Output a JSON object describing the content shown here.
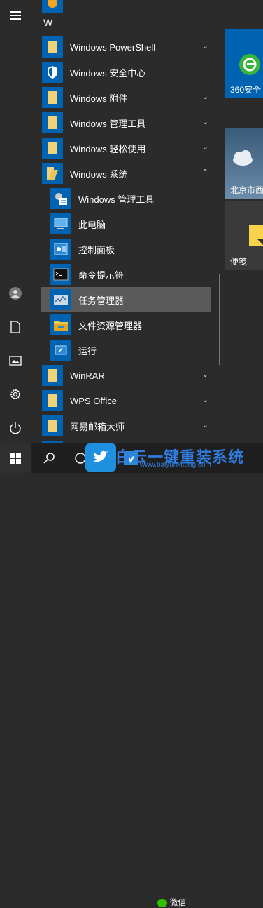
{
  "list": {
    "section_letter": "W",
    "items": [
      {
        "label": "Windows PowerShell",
        "chevron": "⌄"
      },
      {
        "label": "Windows 安全中心"
      },
      {
        "label": "Windows 附件",
        "chevron": "⌄"
      },
      {
        "label": "Windows 管理工具",
        "chevron": "⌄"
      },
      {
        "label": "Windows 轻松使用",
        "chevron": "⌄"
      },
      {
        "label": "Windows 系统",
        "chevron": "⌃"
      },
      {
        "label": "Windows 管理工具"
      },
      {
        "label": "此电脑"
      },
      {
        "label": "控制面板"
      },
      {
        "label": "命令提示符"
      },
      {
        "label": "任务管理器"
      },
      {
        "label": "文件资源管理器"
      },
      {
        "label": "运行"
      },
      {
        "label": "WinRAR",
        "chevron": "⌄"
      },
      {
        "label": "WPS Office",
        "chevron": "⌄"
      },
      {
        "label": "网易邮箱大师",
        "chevron": "⌄"
      }
    ]
  },
  "tiles": {
    "t1": "360安全",
    "t2": "北京市西",
    "t3": "便笺"
  },
  "taskbar": {
    "watermark": "白云一键重装系统",
    "watermark_url": "www.baiyunxitong.com",
    "wechat": "微信"
  },
  "colors": {
    "accent": "#0063b1",
    "folder": "#f0d27a",
    "highlight": "#5a5a5a"
  }
}
